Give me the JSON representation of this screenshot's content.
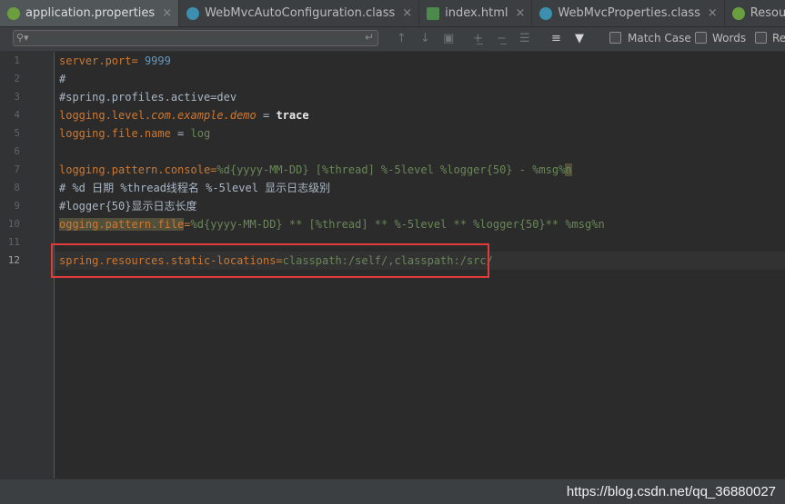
{
  "tabs": [
    {
      "label": "application.properties",
      "icon": "spring-properties-icon",
      "active": true
    },
    {
      "label": "WebMvcAutoConfiguration.class",
      "icon": "class-file-icon",
      "active": false
    },
    {
      "label": "index.html",
      "icon": "html-file-icon",
      "active": false
    },
    {
      "label": "WebMvcProperties.class",
      "icon": "class-file-icon",
      "active": false
    },
    {
      "label": "ResourceLoader.cla",
      "icon": "interface-file-icon",
      "active": false
    }
  ],
  "close_glyph": "×",
  "search": {
    "placeholder": "",
    "options": {
      "match_case": "Match Case",
      "words": "Words",
      "regex": "Re"
    }
  },
  "editor": {
    "lines": [
      {
        "num": "1"
      },
      {
        "num": "2"
      },
      {
        "num": "3"
      },
      {
        "num": "4"
      },
      {
        "num": "5"
      },
      {
        "num": "6"
      },
      {
        "num": "7"
      },
      {
        "num": "8"
      },
      {
        "num": "9"
      },
      {
        "num": "10"
      },
      {
        "num": "11"
      },
      {
        "num": "12"
      }
    ],
    "code": {
      "l1_key": "server.port",
      "l1_eq": "= ",
      "l1_val": "9999",
      "l2": "#",
      "l3": "#spring.profiles.active=dev",
      "l4_key_a": "logging.level.",
      "l4_key_b": "com.example.demo",
      "l4_eq": " = ",
      "l4_val": "trace",
      "l5_key": "logging.file.name",
      "l5_eq": " = ",
      "l5_val": "log",
      "l7_key": "logging.pattern.console",
      "l7_eq": "=",
      "l7_val": "%d{yyyy-MM-DD} [%thread] %-5level %logger{50} - %msg%",
      "l7_tail": "n",
      "l8": "# %d 日期 %thread线程名 %-5level 显示日志级别",
      "l9": "#logger{50}显示日志长度",
      "l10_key": "ogging.pattern.file",
      "l10_eq": "=",
      "l10_val": "%d{yyyy-MM-DD} ** [%thread] ** %-5level ** %logger{50}** %msg%n",
      "l12_key": "spring.resources.static-locations",
      "l12_eq": "=",
      "l12_val": "classpath:/self/,classpath:/src/"
    }
  },
  "status": {
    "watermark": "https://blog.csdn.net/qq_36880027"
  },
  "colors": {
    "key": "#cc7832",
    "value": "#6a8759",
    "number": "#6897bb",
    "highlight_box": "#e33a3a"
  }
}
